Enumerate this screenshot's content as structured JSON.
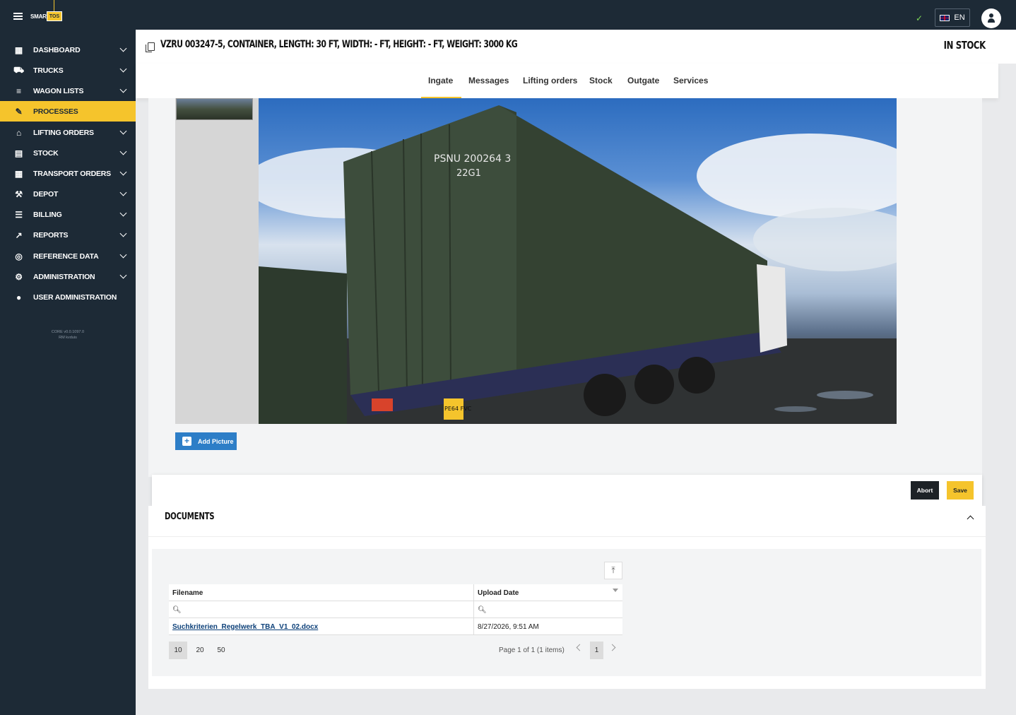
{
  "topbar": {
    "logo_text": "SMART",
    "logo_badge": "TOS",
    "lang": "EN"
  },
  "sidebar": {
    "items": [
      {
        "label": "DASHBOARD",
        "icon": "dashboard-icon",
        "chevron": true
      },
      {
        "label": "TRUCKS",
        "icon": "truck-icon",
        "chevron": true
      },
      {
        "label": "WAGON LISTS",
        "icon": "wagon-icon",
        "chevron": true
      },
      {
        "label": "PROCESSES",
        "icon": "process-icon",
        "chevron": false,
        "active": true
      },
      {
        "label": "LIFTING ORDERS",
        "icon": "lifting-icon",
        "chevron": true
      },
      {
        "label": "STOCK",
        "icon": "stock-icon",
        "chevron": true
      },
      {
        "label": "TRANSPORT ORDERS",
        "icon": "transport-icon",
        "chevron": true
      },
      {
        "label": "DEPOT",
        "icon": "tools-icon",
        "chevron": true
      },
      {
        "label": "BILLING",
        "icon": "billing-icon",
        "chevron": true
      },
      {
        "label": "REPORTS",
        "icon": "reports-icon",
        "chevron": true
      },
      {
        "label": "REFERENCE DATA",
        "icon": "database-icon",
        "chevron": true
      },
      {
        "label": "ADMINISTRATION",
        "icon": "gear-icon",
        "chevron": true
      },
      {
        "label": "USER ADMINISTRATION",
        "icon": "user-icon",
        "chevron": false
      }
    ],
    "version_line1": "CORE v0.0.1097.0",
    "version_line2": "RM kvduis"
  },
  "header": {
    "title": "VZRU 003247-5, CONTAINER, LENGTH: 30 FT, WIDTH: - FT, HEIGHT: - FT, WEIGHT: 3000 KG",
    "status": "IN STOCK"
  },
  "tabs": [
    {
      "label": "Ingate",
      "active": true
    },
    {
      "label": "Messages"
    },
    {
      "label": "Lifting orders"
    },
    {
      "label": "Stock"
    },
    {
      "label": "Outgate"
    },
    {
      "label": "Services"
    }
  ],
  "photo": {
    "container_code_1": "PSNU 200264 3",
    "container_code_2": "22G1",
    "plate": "PE64 FVC"
  },
  "buttons": {
    "add_picture": "Add Picture",
    "abort": "Abort",
    "save": "Save"
  },
  "documents": {
    "title": "DOCUMENTS",
    "columns": [
      "Filename",
      "Upload Date"
    ],
    "rows": [
      {
        "filename": "Suchkriterien_Regelwerk_TBA_V1_02.docx",
        "upload_date": "8/27/2026, 9:51 AM"
      }
    ],
    "page_sizes": [
      "10",
      "20",
      "50"
    ],
    "page_info": "Page 1 of 1 (1 items)",
    "current_page": "1"
  },
  "colors": {
    "dark": "#1d2a36",
    "accent": "#f5c42c",
    "primary": "#2d7ec7"
  }
}
